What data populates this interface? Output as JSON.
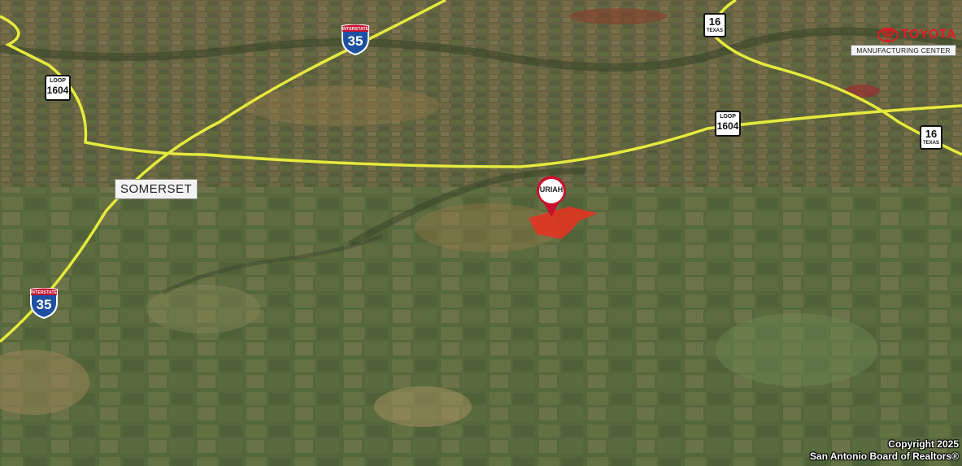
{
  "town": {
    "label": "SOMERSET"
  },
  "interstate_shields": [
    {
      "top": "INTERSTATE",
      "number": "35"
    },
    {
      "top": "INTERSTATE",
      "number": "35"
    }
  ],
  "loop_shields": [
    {
      "top": "LOOP",
      "number": "1604"
    },
    {
      "top": "LOOP",
      "number": "1604"
    }
  ],
  "state_shields": [
    {
      "number": "16",
      "bottom": "TEXAS"
    },
    {
      "number": "16",
      "bottom": "TEXAS"
    }
  ],
  "toyota": {
    "wordmark": "TOYOTA",
    "subtitle": "MANUFACTURING CENTER"
  },
  "property_pin": {
    "label": "URIAH"
  },
  "copyright": {
    "line1": "Copyright 2025",
    "line2": "San Antonio Board of Realtors®"
  },
  "colors": {
    "highway": "#e5ea3c",
    "parcel": "#e8311f",
    "interstate_blue": "#1d4fa3",
    "interstate_red": "#c8102e",
    "toyota_red": "#e01b24"
  }
}
